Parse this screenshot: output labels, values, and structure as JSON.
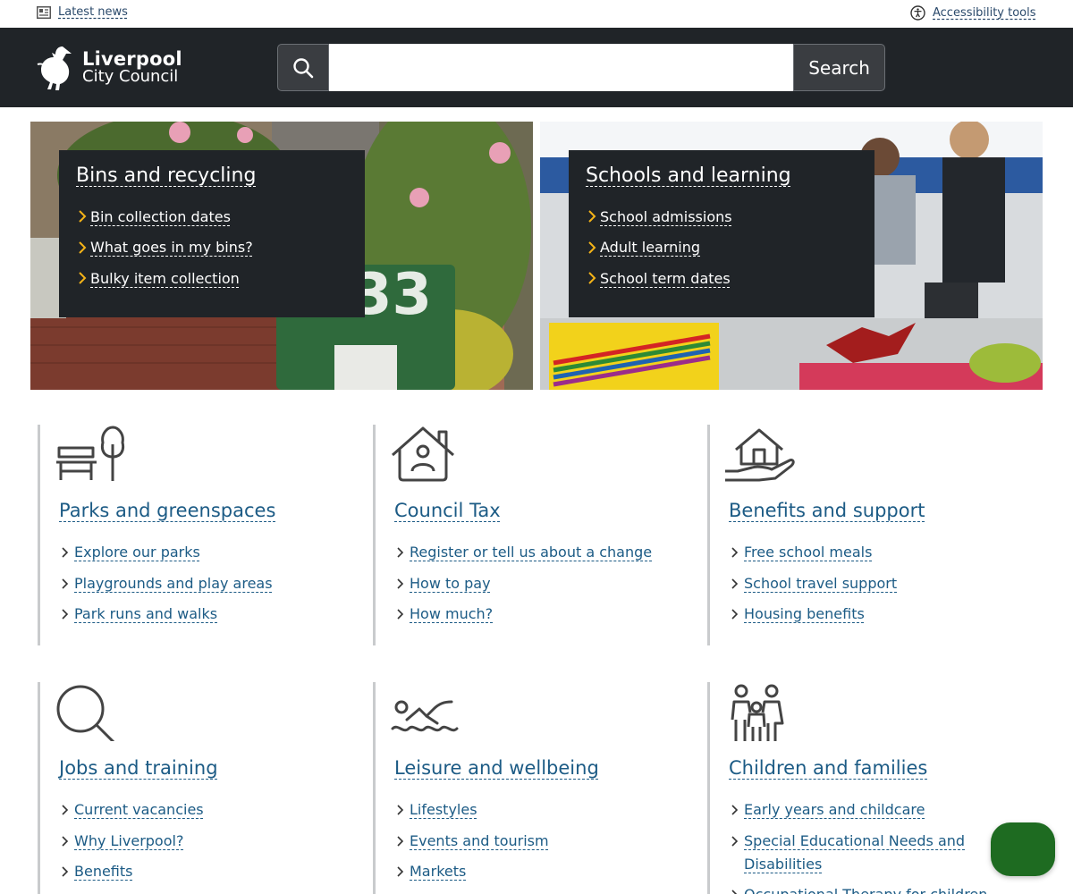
{
  "utility": {
    "latest_news": "Latest news",
    "latest_news_icon": "newspaper-icon",
    "accessibility": "Accessibility tools",
    "accessibility_icon": "accessibility-icon"
  },
  "header": {
    "logo_line1": "Liverpool",
    "logo_line2": "City Council",
    "logo_icon": "liver-bird-icon",
    "search_value": "",
    "search_button": "Search",
    "search_icon": "search-icon",
    "background": "#202428"
  },
  "heroes": [
    {
      "title": "Bins and recycling",
      "links": [
        "Bin collection dates",
        "What goes in my bins?",
        "Bulky item collection"
      ]
    },
    {
      "title": "Schools and learning",
      "links": [
        "School admissions",
        "Adult learning",
        "School term dates"
      ]
    }
  ],
  "cards": [
    {
      "icon": "park-bench-tree-icon",
      "title": "Parks and greenspaces",
      "links": [
        "Explore our parks",
        "Playgrounds and play areas",
        "Park runs and walks"
      ]
    },
    {
      "icon": "house-person-icon",
      "title": "Council Tax",
      "links": [
        "Register or tell us about a change",
        "How to pay",
        "How much?"
      ]
    },
    {
      "icon": "house-hand-icon",
      "title": "Benefits and support",
      "links": [
        "Free school meals",
        "School travel support",
        "Housing benefits"
      ]
    },
    {
      "icon": "magnifying-glass-icon",
      "title": "Jobs and training",
      "links": [
        "Current vacancies",
        "Why Liverpool?",
        "Benefits"
      ]
    },
    {
      "icon": "swimmer-icon",
      "title": "Leisure and wellbeing",
      "links": [
        "Lifestyles",
        "Events and tourism",
        "Markets"
      ]
    },
    {
      "icon": "family-icon",
      "title": "Children and families",
      "links": [
        "Early years and childcare",
        "Special Educational Needs and Disabilities",
        "Occupational Therapy for children"
      ]
    }
  ],
  "colors": {
    "link": "#1c5b85",
    "accent_chevron": "#f5b418",
    "chat_button": "#1e6b21"
  }
}
